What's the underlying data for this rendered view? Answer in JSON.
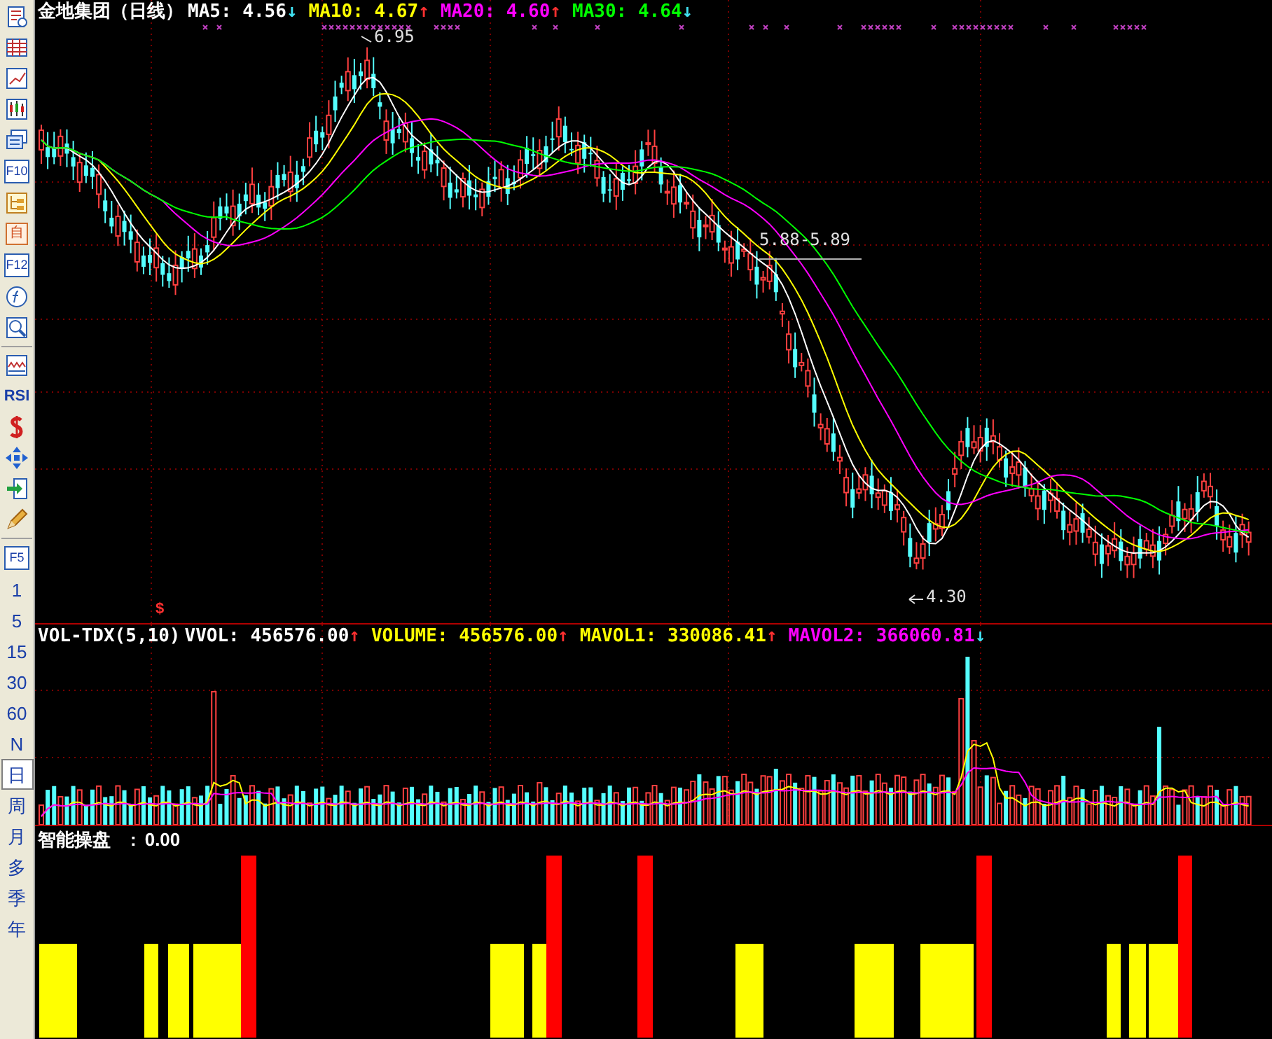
{
  "toolbar": [
    {
      "label": "F10"
    },
    {
      "label": "自"
    },
    {
      "label": "F12"
    },
    {
      "label": "RSI"
    },
    {
      "label": "F5"
    }
  ],
  "periods": [
    {
      "label": "1",
      "selected": false
    },
    {
      "label": "5",
      "selected": false
    },
    {
      "label": "15",
      "selected": false
    },
    {
      "label": "30",
      "selected": false
    },
    {
      "label": "60",
      "selected": false
    },
    {
      "label": "N",
      "selected": false
    },
    {
      "label": "日",
      "selected": true
    },
    {
      "label": "周",
      "selected": false
    },
    {
      "label": "月",
      "selected": false
    },
    {
      "label": "多",
      "selected": false
    },
    {
      "label": "季",
      "selected": false
    },
    {
      "label": "年",
      "selected": false
    }
  ],
  "main_panel": {
    "title": "金地集团（日线）",
    "indicators": [
      {
        "label": "MA5:",
        "value": "4.56",
        "arrow": "↓",
        "kind": "down",
        "color": "#ffffff"
      },
      {
        "label": "MA10:",
        "value": "4.67",
        "arrow": "↑",
        "kind": "up",
        "color": "#ffff00"
      },
      {
        "label": "MA20:",
        "value": "4.60",
        "arrow": "↑",
        "kind": "up",
        "color": "#ff00ff"
      },
      {
        "label": "MA30:",
        "value": "4.64",
        "arrow": "↓",
        "kind": "down",
        "color": "#00ff00"
      }
    ],
    "annotations": [
      "6.95",
      "5.88-5.89",
      "4.30"
    ],
    "signal": "$"
  },
  "volume_panel": {
    "title": "VOL-TDX(5,10)",
    "indicators": [
      {
        "label": "VVOL:",
        "value": "456576.00",
        "arrow": "↑",
        "kind": "up",
        "color": "#ffffff"
      },
      {
        "label": "VOLUME:",
        "value": "456576.00",
        "arrow": "↑",
        "kind": "up",
        "color": "#ffff00"
      },
      {
        "label": "MAVOL1:",
        "value": "330086.41",
        "arrow": "↑",
        "kind": "up",
        "color": "#ffff00"
      },
      {
        "label": "MAVOL2:",
        "value": "366060.81",
        "arrow": "↓",
        "kind": "down",
        "color": "#ff00ff"
      }
    ]
  },
  "signal_panel": {
    "label": "智能操盘",
    "separator": ":",
    "value": "0.00"
  }
}
